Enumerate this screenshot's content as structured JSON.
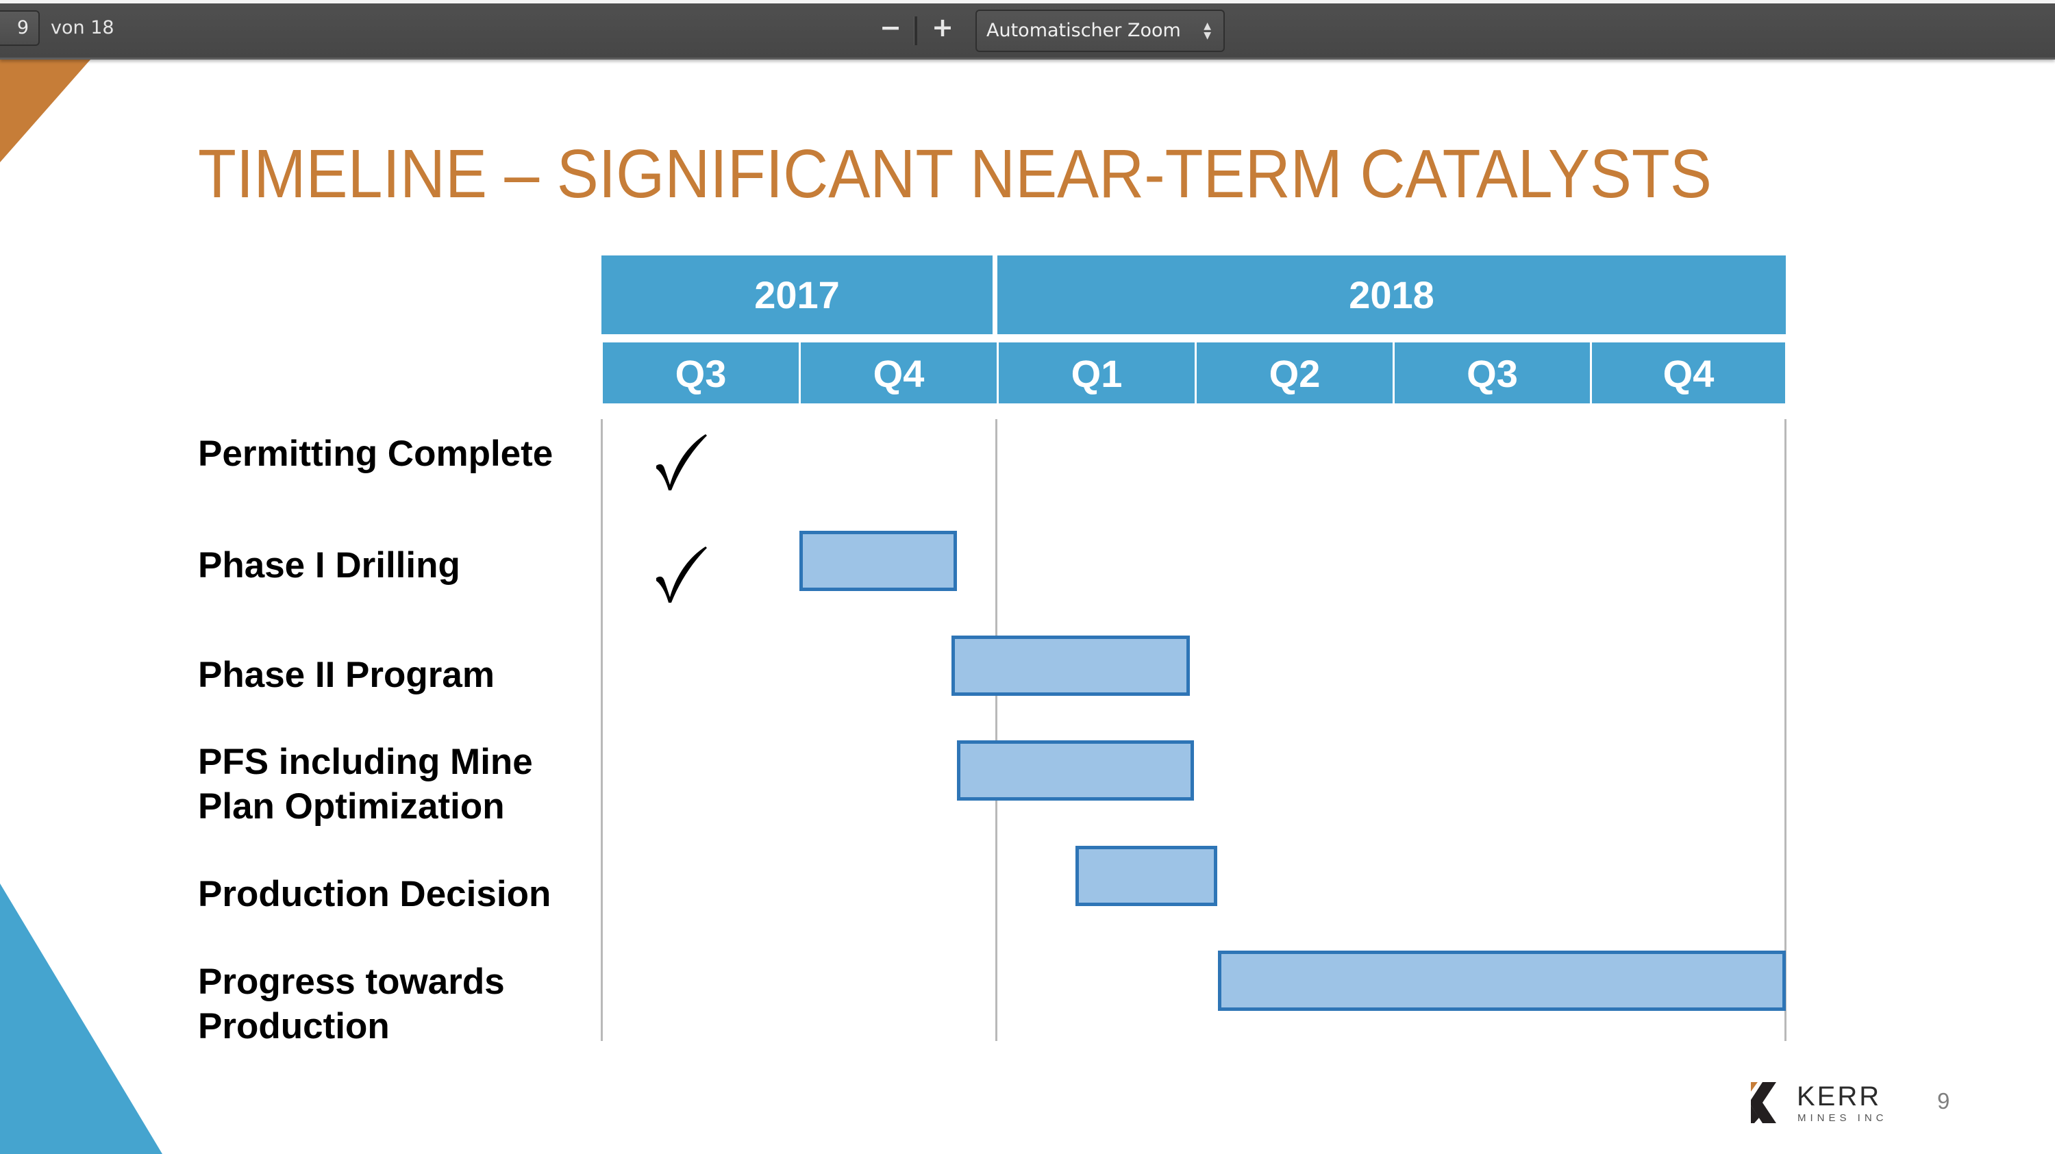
{
  "toolbar": {
    "page_number": "9",
    "page_count_label": "von 18",
    "zoom_out_label": "−",
    "zoom_in_label": "+",
    "zoom_select_value": "Automatischer Zoom",
    "zoom_select_arrows": "▲▼"
  },
  "slide": {
    "title": "TIMELINE – SIGNIFICANT NEAR-TERM CATALYSTS",
    "page_number": "9",
    "colors": {
      "title": "#C67D38",
      "header": "#47A2CF",
      "bar_fill": "#9DC3E6",
      "bar_border": "#2E75B6",
      "accent_triangle_top": "#C67D38",
      "accent_triangle_bottom": "#45A4CF"
    },
    "logo": {
      "name": "KERR",
      "subtitle": "MINES INC"
    }
  },
  "chart_data": {
    "type": "gantt",
    "title": "TIMELINE – SIGNIFICANT NEAR-TERM CATALYSTS",
    "years": [
      {
        "label": "2017",
        "quarters": 2
      },
      {
        "label": "2018",
        "quarters": 4
      }
    ],
    "quarters": [
      "Q3",
      "Q4",
      "Q1",
      "Q2",
      "Q3",
      "Q4"
    ],
    "x_unit": "quarters from start of Q3 2017",
    "xlim": [
      0,
      6
    ],
    "tasks": [
      {
        "label": "Permitting Complete",
        "completed": true,
        "bar": null
      },
      {
        "label": "Phase I Drilling",
        "completed": true,
        "bar": {
          "start": 1.0,
          "end": 1.8
        }
      },
      {
        "label": "Phase II Program",
        "completed": false,
        "bar": {
          "start": 1.77,
          "end": 2.98
        }
      },
      {
        "label": "PFS including Mine\nPlan Optimization",
        "completed": false,
        "bar": {
          "start": 1.8,
          "end": 3.0
        }
      },
      {
        "label": "Production Decision",
        "completed": false,
        "bar": {
          "start": 2.4,
          "end": 3.12
        }
      },
      {
        "label": "Progress towards\nProduction",
        "completed": false,
        "bar": {
          "start": 3.12,
          "end": 6.0
        }
      }
    ],
    "gridlines_at": [
      0,
      2,
      6
    ]
  }
}
